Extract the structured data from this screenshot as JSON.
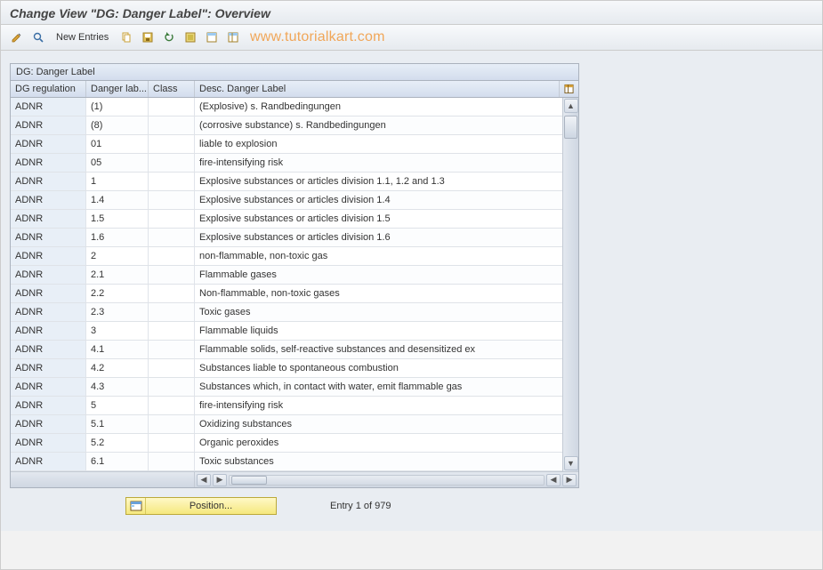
{
  "title": "Change View \"DG: Danger Label\": Overview",
  "watermark": "www.tutorialkart.com",
  "toolbar": {
    "new_entries_label": "New Entries"
  },
  "table": {
    "title": "DG: Danger Label",
    "columns": {
      "reg": "DG regulation",
      "lab": "Danger lab...",
      "cls": "Class",
      "dsc": "Desc. Danger Label"
    },
    "rows": [
      {
        "reg": "ADNR",
        "lab": "(1)",
        "cls": "",
        "dsc": "(Explosive) s. Randbedingungen"
      },
      {
        "reg": "ADNR",
        "lab": "(8)",
        "cls": "",
        "dsc": "(corrosive substance) s. Randbedingungen"
      },
      {
        "reg": "ADNR",
        "lab": "01",
        "cls": "",
        "dsc": "liable to explosion"
      },
      {
        "reg": "ADNR",
        "lab": "05",
        "cls": "",
        "dsc": "fire-intensifying risk"
      },
      {
        "reg": "ADNR",
        "lab": "1",
        "cls": "",
        "dsc": "Explosive substances or articles division 1.1, 1.2 and 1.3"
      },
      {
        "reg": "ADNR",
        "lab": "1.4",
        "cls": "",
        "dsc": "Explosive substances or articles division 1.4"
      },
      {
        "reg": "ADNR",
        "lab": "1.5",
        "cls": "",
        "dsc": "Explosive substances or articles division 1.5"
      },
      {
        "reg": "ADNR",
        "lab": "1.6",
        "cls": "",
        "dsc": "Explosive substances or articles division 1.6"
      },
      {
        "reg": "ADNR",
        "lab": "2",
        "cls": "",
        "dsc": "non-flammable, non-toxic gas"
      },
      {
        "reg": "ADNR",
        "lab": "2.1",
        "cls": "",
        "dsc": "Flammable gases"
      },
      {
        "reg": "ADNR",
        "lab": "2.2",
        "cls": "",
        "dsc": "Non-flammable, non-toxic gases"
      },
      {
        "reg": "ADNR",
        "lab": "2.3",
        "cls": "",
        "dsc": "Toxic gases"
      },
      {
        "reg": "ADNR",
        "lab": "3",
        "cls": "",
        "dsc": "Flammable liquids"
      },
      {
        "reg": "ADNR",
        "lab": "4.1",
        "cls": "",
        "dsc": "Flammable solids, self-reactive substances and desensitized ex"
      },
      {
        "reg": "ADNR",
        "lab": "4.2",
        "cls": "",
        "dsc": "Substances liable to spontaneous combustion"
      },
      {
        "reg": "ADNR",
        "lab": "4.3",
        "cls": "",
        "dsc": "Substances which, in contact with water, emit flammable gas"
      },
      {
        "reg": "ADNR",
        "lab": "5",
        "cls": "",
        "dsc": "fire-intensifying risk"
      },
      {
        "reg": "ADNR",
        "lab": "5.1",
        "cls": "",
        "dsc": "Oxidizing substances"
      },
      {
        "reg": "ADNR",
        "lab": "5.2",
        "cls": "",
        "dsc": "Organic peroxides"
      },
      {
        "reg": "ADNR",
        "lab": "6.1",
        "cls": "",
        "dsc": "Toxic substances"
      }
    ]
  },
  "footer": {
    "position_label": "Position...",
    "entry_text": "Entry 1 of 979"
  }
}
